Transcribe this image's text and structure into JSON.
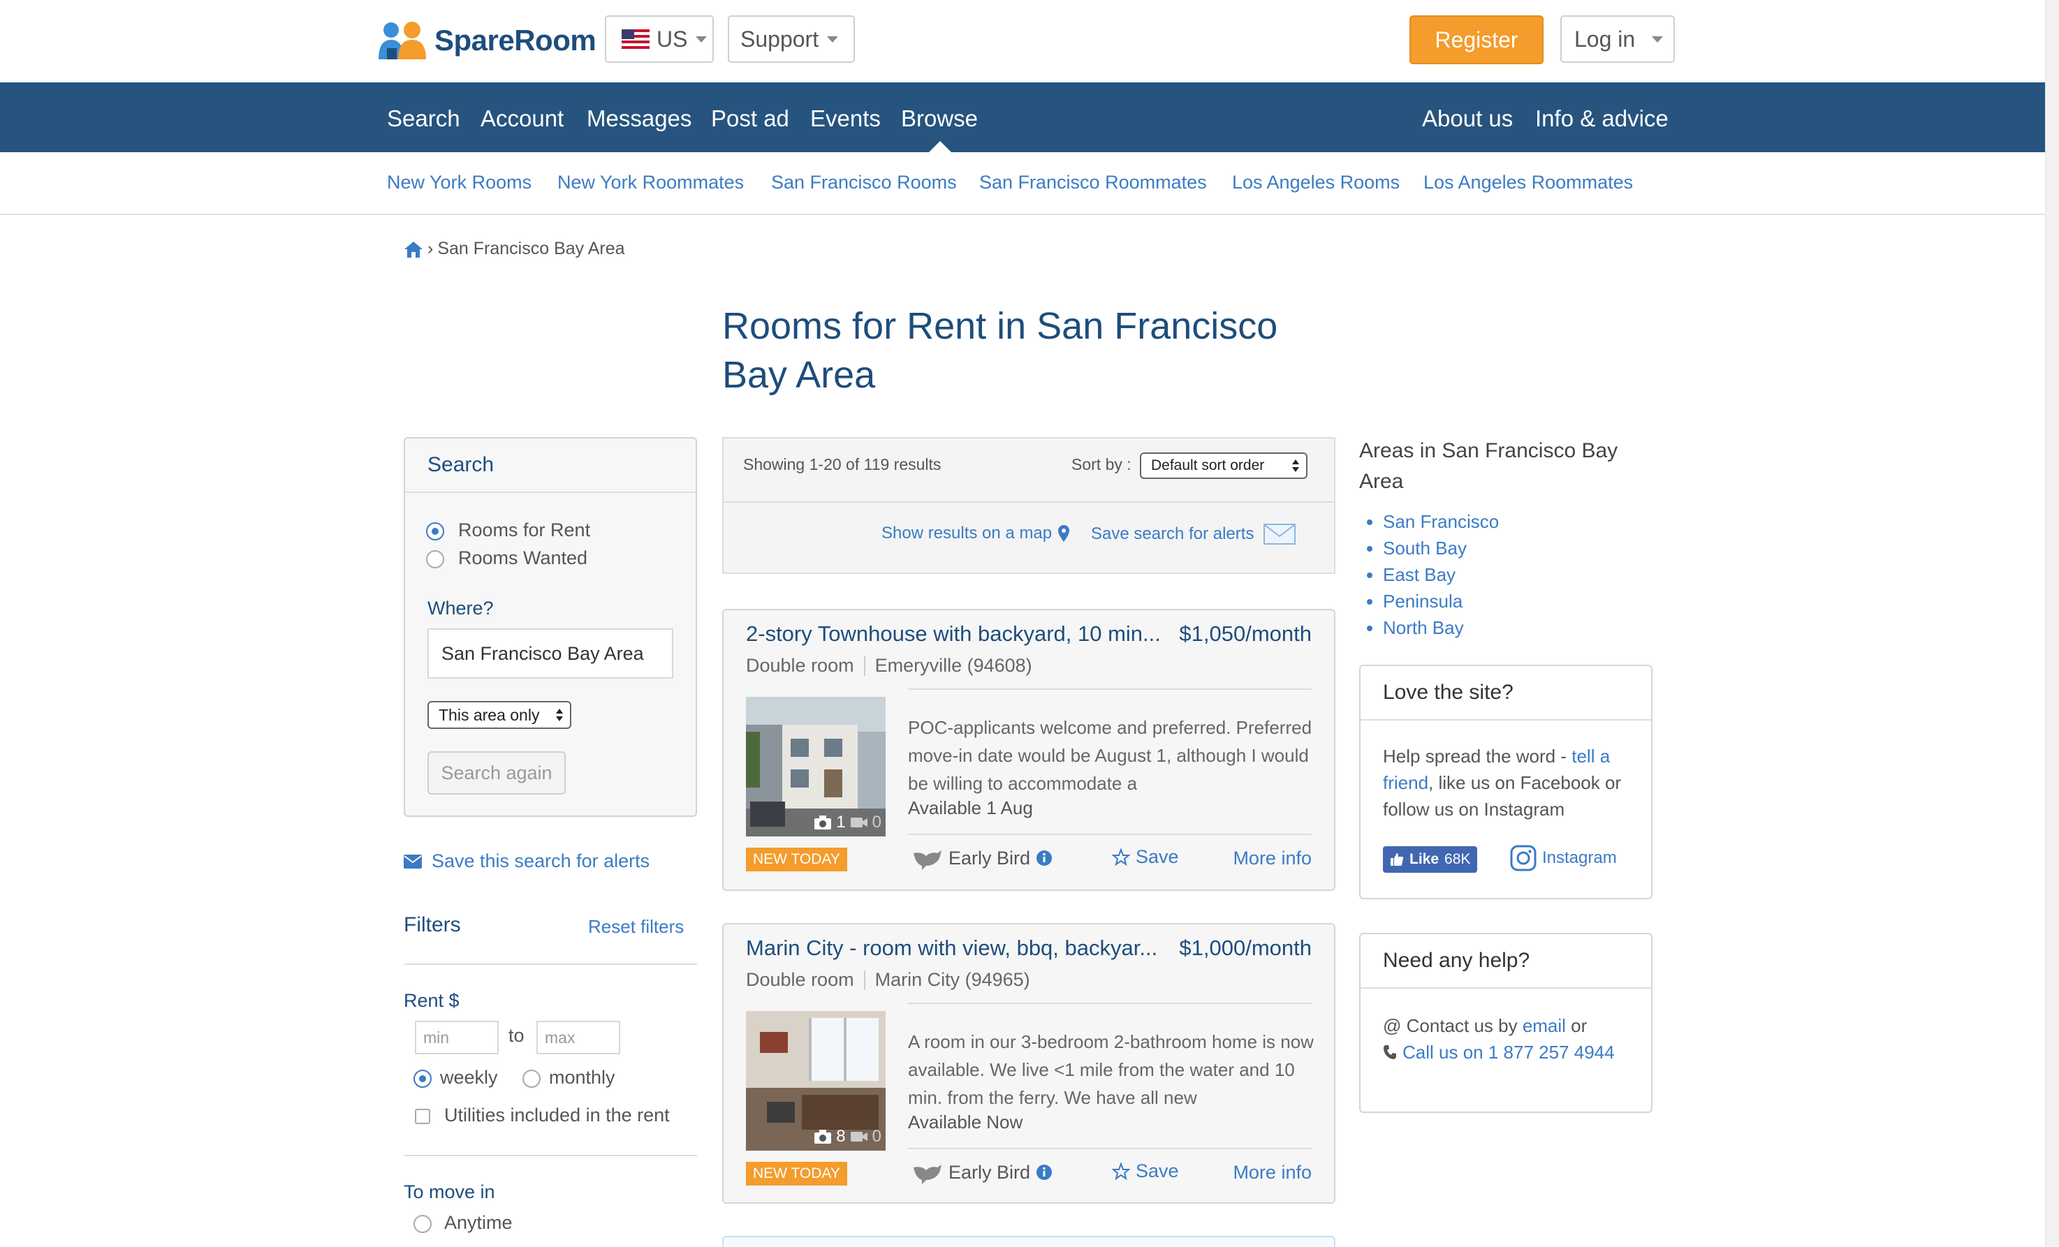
{
  "header": {
    "logo_text": "SpareRoom",
    "country": "US",
    "support": "Support",
    "register": "Register",
    "login": "Log in"
  },
  "nav": {
    "left": [
      "Search",
      "Account",
      "Messages",
      "Post ad",
      "Events",
      "Browse"
    ],
    "right": [
      "About us",
      "Info & advice"
    ]
  },
  "subnav": [
    "New York Rooms",
    "New York Roommates",
    "San Francisco Rooms",
    "San Francisco Roommates",
    "Los Angeles Rooms",
    "Los Angeles Roommates"
  ],
  "breadcrumb": {
    "sep": "›",
    "current": "San Francisco Bay Area"
  },
  "page_title": "Rooms for Rent in San Francisco Bay Area",
  "search_panel": {
    "heading": "Search",
    "options": [
      "Rooms for Rent",
      "Rooms Wanted"
    ],
    "where_label": "Where?",
    "where_value": "San Francisco Bay Area",
    "area_scope": "This area only",
    "search_again": "Search again",
    "save_alerts": "Save this search for alerts"
  },
  "filters": {
    "heading": "Filters",
    "reset": "Reset filters",
    "rent_label": "Rent $",
    "min_placeholder": "min",
    "to": "to",
    "max_placeholder": "max",
    "period_weekly": "weekly",
    "period_monthly": "monthly",
    "utilities": "Utilities included in the rent",
    "move_in_label": "To move in",
    "anytime": "Anytime"
  },
  "results": {
    "showing": "Showing 1-20 of 119 results",
    "sort_label": "Sort by :",
    "sort_value": "Default sort order",
    "show_map": "Show results on a map",
    "save_search": "Save search for alerts"
  },
  "listings": [
    {
      "title": "2-story Townhouse with backyard, 10 min...",
      "price": "$1,050/month",
      "room_type": "Double room",
      "location": "Emeryville (94608)",
      "photos": "1",
      "videos": "0",
      "description": "POC-applicants welcome and preferred. Preferred move-in date would be August 1, although I would be willing to accommodate a",
      "available": "Available 1 Aug",
      "badge": "NEW TODAY",
      "early_bird": "Early Bird",
      "save": "Save",
      "more": "More info"
    },
    {
      "title": "Marin City - room with view, bbq, backyar...",
      "price": "$1,000/month",
      "room_type": "Double room",
      "location": "Marin City (94965)",
      "photos": "8",
      "videos": "0",
      "description": "A room in our 3-bedroom 2-bathroom home is now available. We live <1 mile from the water and 10 min. from the ferry. We have all new",
      "available": "Available Now",
      "badge": "NEW TODAY",
      "early_bird": "Early Bird",
      "save": "Save",
      "more": "More info"
    }
  ],
  "sidebar": {
    "areas_title": "Areas in San Francisco Bay Area",
    "areas": [
      "San Francisco",
      "South Bay",
      "East Bay",
      "Peninsula",
      "North Bay"
    ],
    "love": {
      "heading": "Love the site?",
      "text_before": "Help spread the word - ",
      "tell_friend": "tell a friend",
      "text_after": ", like us on Facebook or follow us on Instagram",
      "fb_like": "Like",
      "fb_count": "68K",
      "instagram": "Instagram"
    },
    "help": {
      "heading": "Need any help?",
      "contact_prefix": "@ Contact us by ",
      "email": "email",
      "contact_suffix": " or",
      "call": "Call us on 1 877 257 4944"
    }
  },
  "colors": {
    "brand_blue": "#26547f",
    "link_blue": "#3b7bc4",
    "accent_orange": "#f49c2c"
  }
}
